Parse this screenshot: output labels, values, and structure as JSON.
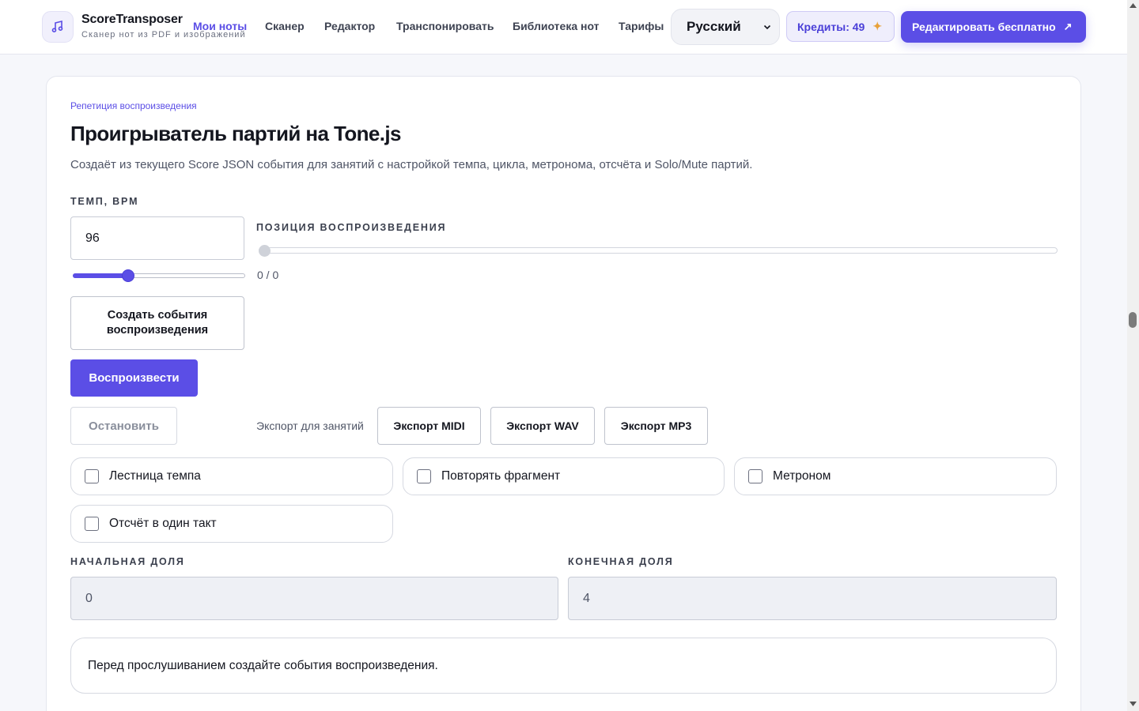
{
  "header": {
    "brand_name": "ScoreTransposer",
    "brand_subtitle": "Сканер нот из PDF и изображений",
    "nav": [
      {
        "label": "Мои ноты",
        "active": true
      },
      {
        "label": "Сканер",
        "active": false
      },
      {
        "label": "Редактор",
        "active": false
      },
      {
        "label": "Транспонировать",
        "active": false
      },
      {
        "label": "Библиотека нот",
        "active": false
      },
      {
        "label": "Тарифы",
        "active": false
      }
    ],
    "language": "Русский",
    "credits_label": "Кредиты: 49",
    "cta_label": "Редактировать бесплатно",
    "icons": {
      "logo": "music-note-icon",
      "spark": "sparkle-icon",
      "cta_arrow": "arrow-up-right-icon",
      "caret": "chevron-down-icon"
    }
  },
  "player": {
    "eyebrow": "Репетиция воспроизведения",
    "title": "Проигрыватель партий на Tone.js",
    "description": "Создаёт из текущего Score JSON события для занятий с настройкой темпа, цикла, метронома, отсчёта и Solo/Mute партий.",
    "tempo_label": "ТЕМП, BPM",
    "tempo_value": "96",
    "tempo_slider_fraction": 0.32,
    "position_label": "ПОЗИЦИЯ ВОСПРОИЗВЕДЕНИЯ",
    "position_readout": "0 / 0",
    "position_fraction": 0,
    "create_events_label": "Создать события воспроизведения",
    "play_label": "Воспроизвести",
    "stop_label": "Остановить",
    "export_label": "Экспорт для занятий",
    "export_midi": "Экспорт MIDI",
    "export_wav": "Экспорт WAV",
    "export_mp3": "Экспорт MP3",
    "options": {
      "tempo_ladder": "Лестница темпа",
      "loop": "Повторять фрагмент",
      "metronome": "Метроном",
      "count_in": "Отсчёт в один такт"
    },
    "start_beat_label": "НАЧАЛЬНАЯ ДОЛЯ",
    "start_beat_value": "0",
    "end_beat_label": "КОНЕЧНАЯ ДОЛЯ",
    "end_beat_value": "4",
    "status_message": "Перед прослушиванием создайте события воспроизведения."
  },
  "colors": {
    "accent": "#5b4ee6",
    "background": "#f6f7fb",
    "card": "#ffffff"
  }
}
